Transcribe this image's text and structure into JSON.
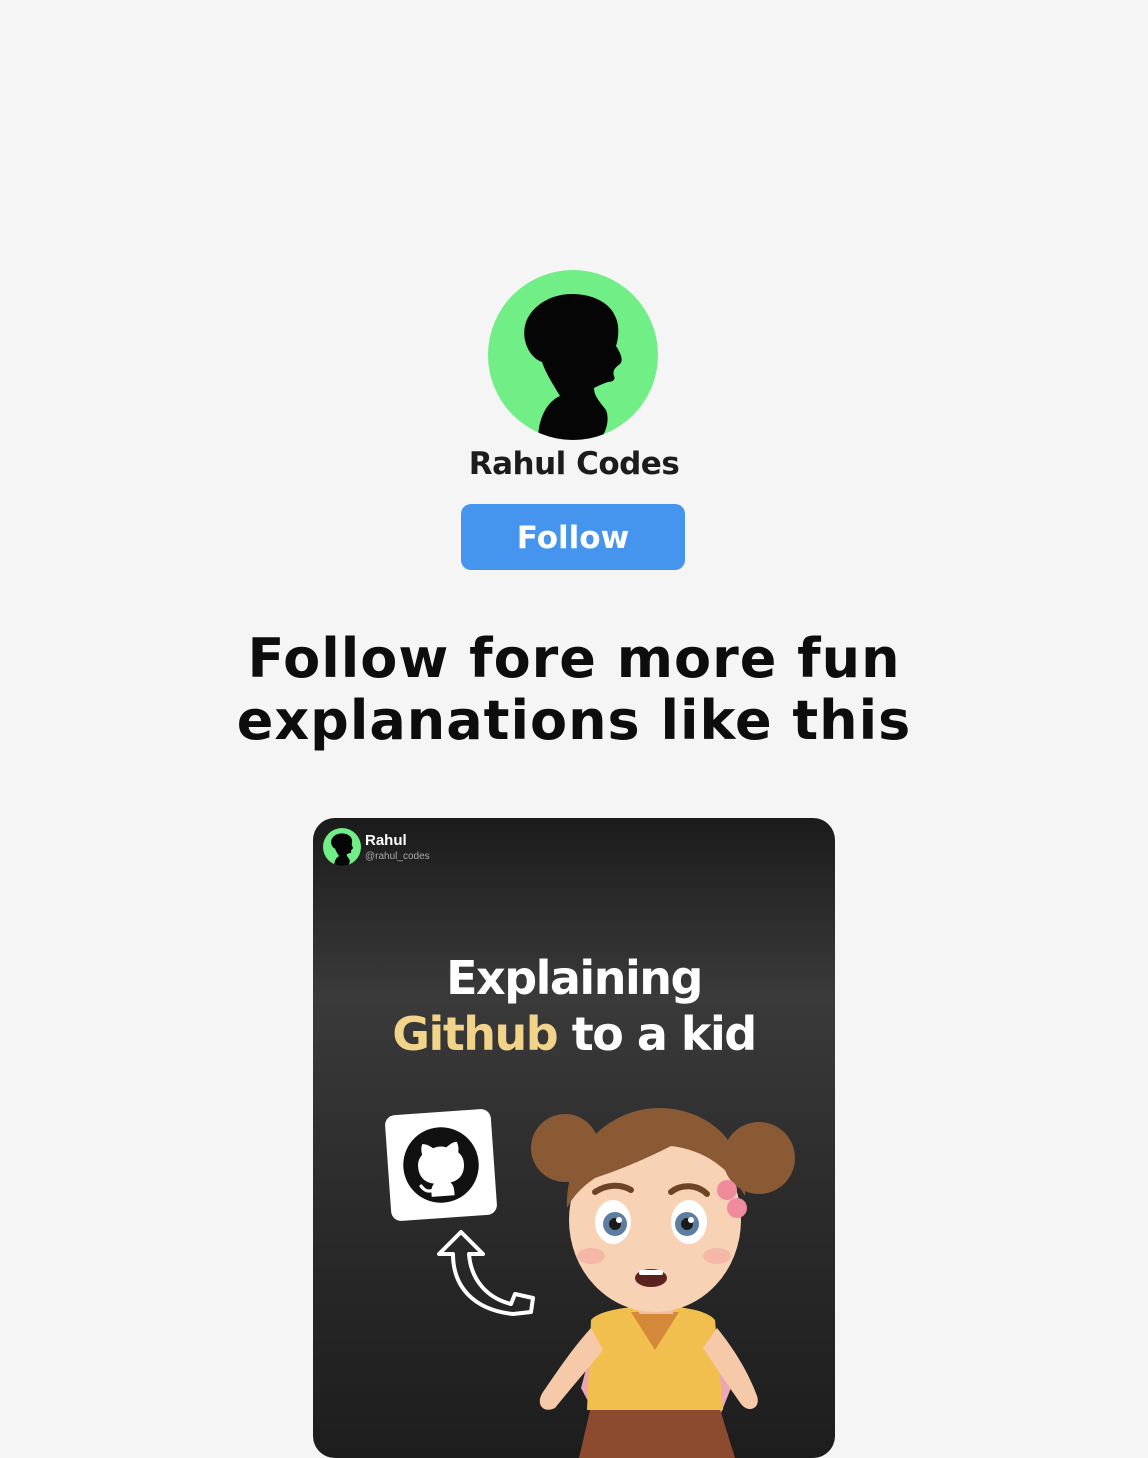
{
  "profile": {
    "avatar_icon": "person-silhouette-icon",
    "avatar_color": "#72ee86",
    "name": "Rahul Codes",
    "follow_label": "Follow",
    "follow_color": "#4595ee"
  },
  "tagline": {
    "line1": "Follow fore more fun",
    "line2": "explanations like this"
  },
  "post": {
    "author": "Rahul",
    "handle": "@rahul_codes",
    "title_line1": "Explaining",
    "title_highlight": "Github",
    "title_rest": " to a kid",
    "highlight_color": "#f1d389",
    "logo_icon": "github-icon",
    "arrow_icon": "curved-arrow-icon",
    "illustration": "confused-kid-illustration"
  }
}
